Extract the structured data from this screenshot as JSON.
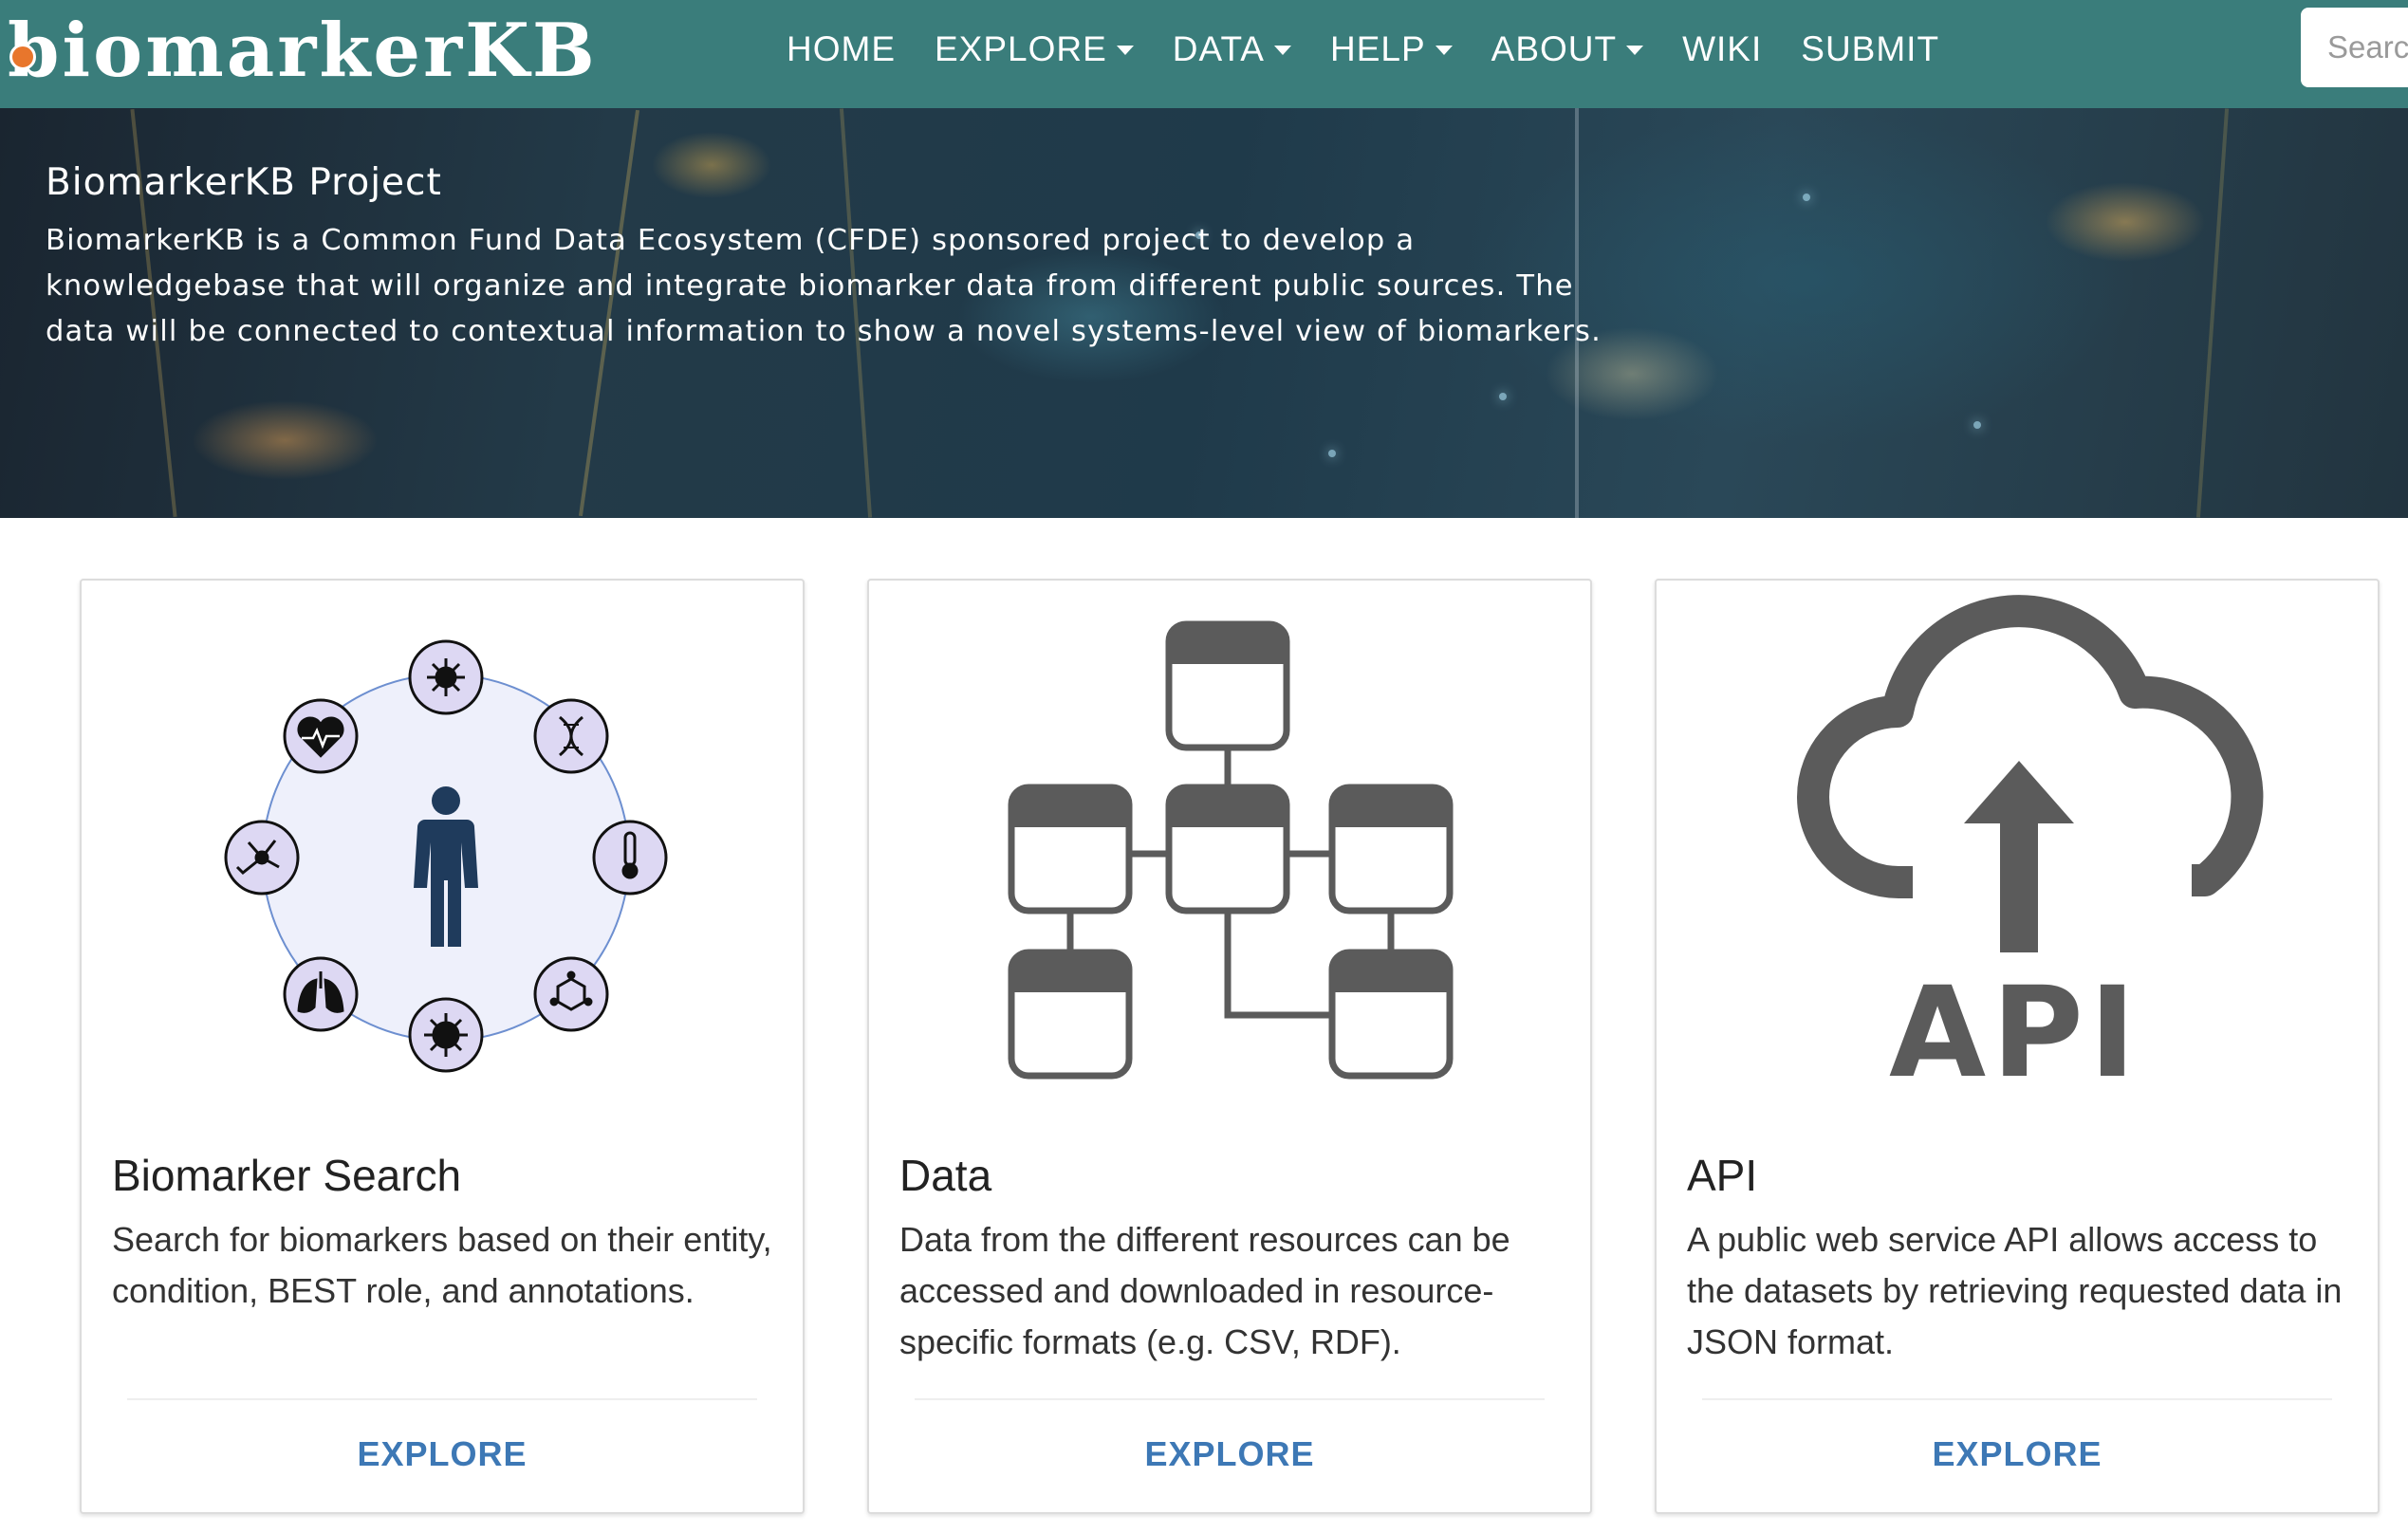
{
  "navbar": {
    "logo_text": "biomarkerKB",
    "menu": [
      {
        "label": "HOME",
        "dropdown": false
      },
      {
        "label": "EXPLORE",
        "dropdown": true
      },
      {
        "label": "DATA",
        "dropdown": true
      },
      {
        "label": "HELP",
        "dropdown": true
      },
      {
        "label": "ABOUT",
        "dropdown": true
      },
      {
        "label": "WIKI",
        "dropdown": false
      },
      {
        "label": "SUBMIT",
        "dropdown": false
      }
    ],
    "search_placeholder": "Search"
  },
  "hero": {
    "title": "BiomarkerKB Project",
    "text": "BiomarkerKB is a Common Fund Data Ecosystem (CFDE) sponsored project to develop a knowledgebase that will organize and integrate biomarker data from different public sources. The data will be connected to contextual information to show a novel systems-level view of biomarkers."
  },
  "cards": [
    {
      "title": "Biomarker Search",
      "text": "Search for biomarkers based on their entity, condition, BEST role, and annotations.",
      "button": "EXPLORE",
      "icon": "biomarker-circle-icon"
    },
    {
      "title": "Data",
      "text": "Data from the different resources can be accessed and downloaded in resource-specific formats (e.g. CSV, RDF).",
      "button": "EXPLORE",
      "icon": "data-tables-icon"
    },
    {
      "title": "API",
      "text": "A public web service API allows access to the datasets by retrieving requested data in JSON format.",
      "button": "EXPLORE",
      "icon": "cloud-upload-api-icon",
      "icon_text": "API"
    }
  ],
  "colors": {
    "navbar_bg": "#3a7d7b",
    "link_blue": "#3d78b5",
    "icon_gray": "#5b5b5b",
    "circle_fill": "#eef0fb",
    "circle_stroke": "#6d8fd0",
    "node_fill": "#ddd8f3"
  }
}
